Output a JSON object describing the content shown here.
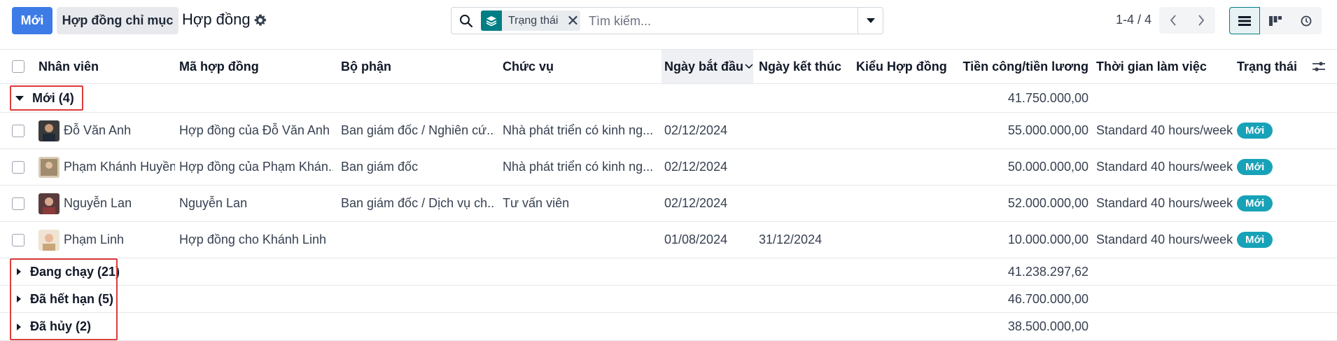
{
  "toolbar": {
    "new_label": "Mới",
    "index_label": "Hợp đồng chỉ mục",
    "title": "Hợp đồng",
    "gear_icon": "gear-icon"
  },
  "search": {
    "facet_icon": "layers-icon",
    "facet_label": "Trạng thái",
    "facet_remove": "✕",
    "placeholder": "Tìm kiếm..."
  },
  "pager": {
    "value": "1-4 / 4"
  },
  "colors": {
    "primary": "#3d7be6",
    "teal": "#017e84",
    "badge": "#17a2b8",
    "highlight": "#dc3c3c"
  },
  "columns": {
    "employee": "Nhân viên",
    "contract": "Mã hợp đồng",
    "department": "Bộ phận",
    "job": "Chức vụ",
    "start": "Ngày bắt đầu",
    "end": "Ngày kết thúc",
    "type": "Kiểu Hợp đồng",
    "wage": "Tiền công/tiền lương",
    "schedule": "Thời gian làm việc",
    "status": "Trạng thái"
  },
  "groups": {
    "new": {
      "label": "Mới (4)",
      "total": "41.750.000,00"
    },
    "running": {
      "label": "Đang chạy (21)",
      "total": "41.238.297,62"
    },
    "expired": {
      "label": "Đã hết hạn (5)",
      "total": "46.700.000,00"
    },
    "cancelled": {
      "label": "Đã hủy (2)",
      "total": "38.500.000,00"
    }
  },
  "rows": [
    {
      "employee": "Đỗ Văn Anh",
      "contract": "Hợp đồng của Đỗ Văn Anh",
      "department": "Ban giám đốc / Nghiên cứ...",
      "job": "Nhà phát triển có kinh ng...",
      "start": "02/12/2024",
      "end": "",
      "type": "",
      "wage": "55.000.000,00",
      "schedule": "Standard 40 hours/week",
      "status": "Mới"
    },
    {
      "employee": "Phạm Khánh Huyền",
      "contract": "Hợp đồng của Phạm Khán...",
      "department": "Ban giám đốc",
      "job": "Nhà phát triển có kinh ng...",
      "start": "02/12/2024",
      "end": "",
      "type": "",
      "wage": "50.000.000,00",
      "schedule": "Standard 40 hours/week",
      "status": "Mới"
    },
    {
      "employee": "Nguyễn Lan",
      "contract": "Nguyễn Lan",
      "department": "Ban giám đốc / Dịch vụ ch...",
      "job": "Tư vấn viên",
      "start": "02/12/2024",
      "end": "",
      "type": "",
      "wage": "52.000.000,00",
      "schedule": "Standard 40 hours/week",
      "status": "Mới"
    },
    {
      "employee": "Phạm Linh",
      "contract": "Hợp đồng cho Khánh Linh",
      "department": "",
      "job": "",
      "start": "01/08/2024",
      "end": "31/12/2024",
      "type": "",
      "wage": "10.000.000,00",
      "schedule": "Standard 40 hours/week",
      "status": "Mới"
    }
  ]
}
